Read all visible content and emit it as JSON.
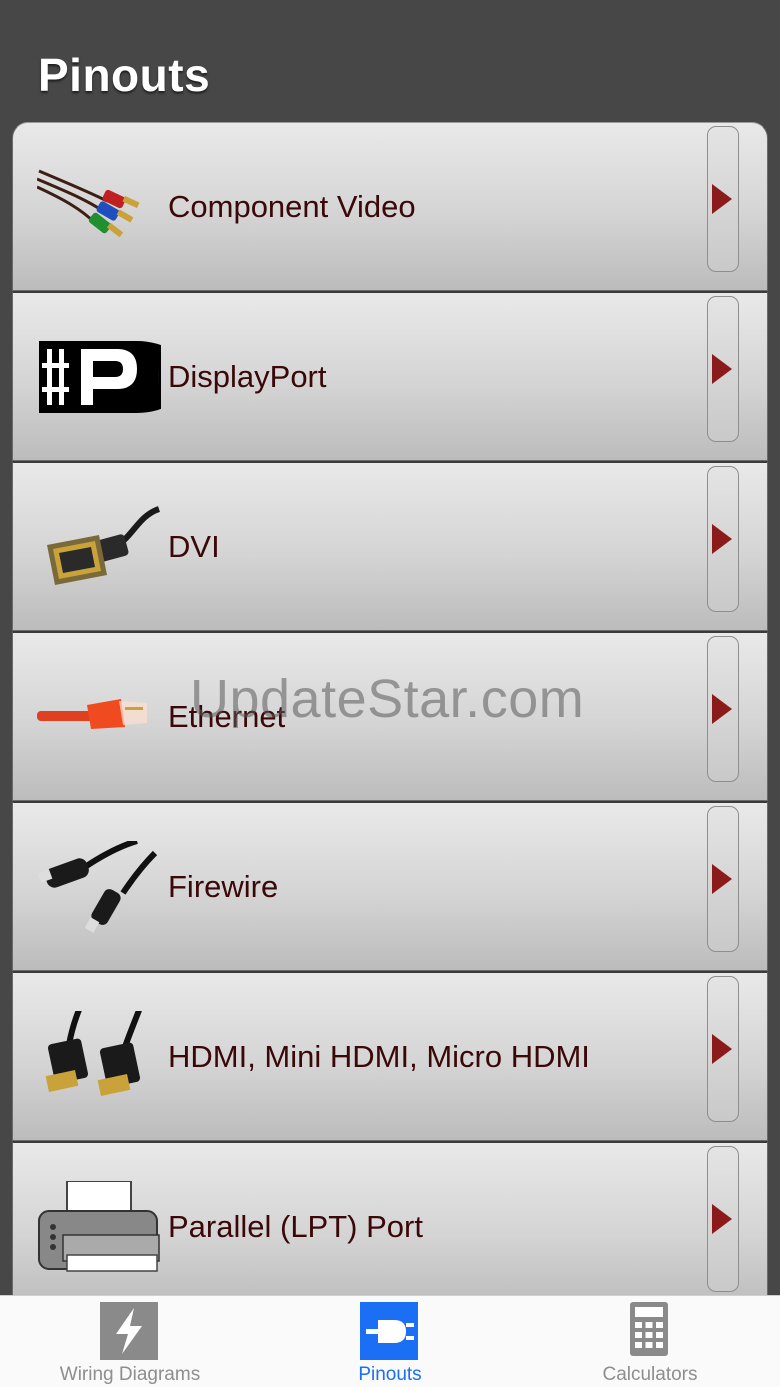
{
  "header": {
    "title": "Pinouts"
  },
  "list": {
    "items": [
      {
        "label": "Component Video",
        "icon": "component-video-cable-icon"
      },
      {
        "label": "DisplayPort",
        "icon": "displayport-logo-icon"
      },
      {
        "label": "DVI",
        "icon": "dvi-cable-icon"
      },
      {
        "label": "Ethernet",
        "icon": "ethernet-cable-icon"
      },
      {
        "label": "Firewire",
        "icon": "firewire-cable-icon"
      },
      {
        "label": "HDMI, Mini HDMI, Micro HDMI",
        "icon": "hdmi-cable-icon"
      },
      {
        "label": "Parallel (LPT) Port",
        "icon": "printer-icon"
      }
    ]
  },
  "watermark": "UpdateStar.com",
  "tabbar": {
    "tabs": [
      {
        "label": "Wiring Diagrams",
        "icon": "lightning-bolt-icon",
        "active": false
      },
      {
        "label": "Pinouts",
        "icon": "plug-icon",
        "active": true
      },
      {
        "label": "Calculators",
        "icon": "calculator-icon",
        "active": false
      }
    ]
  },
  "colors": {
    "header_bg": "#474747",
    "row_label": "#3a0808",
    "disclosure_arrow": "#8b1a1a",
    "active_tab": "#1a6ff5",
    "inactive_tab": "#8e8e8e"
  }
}
